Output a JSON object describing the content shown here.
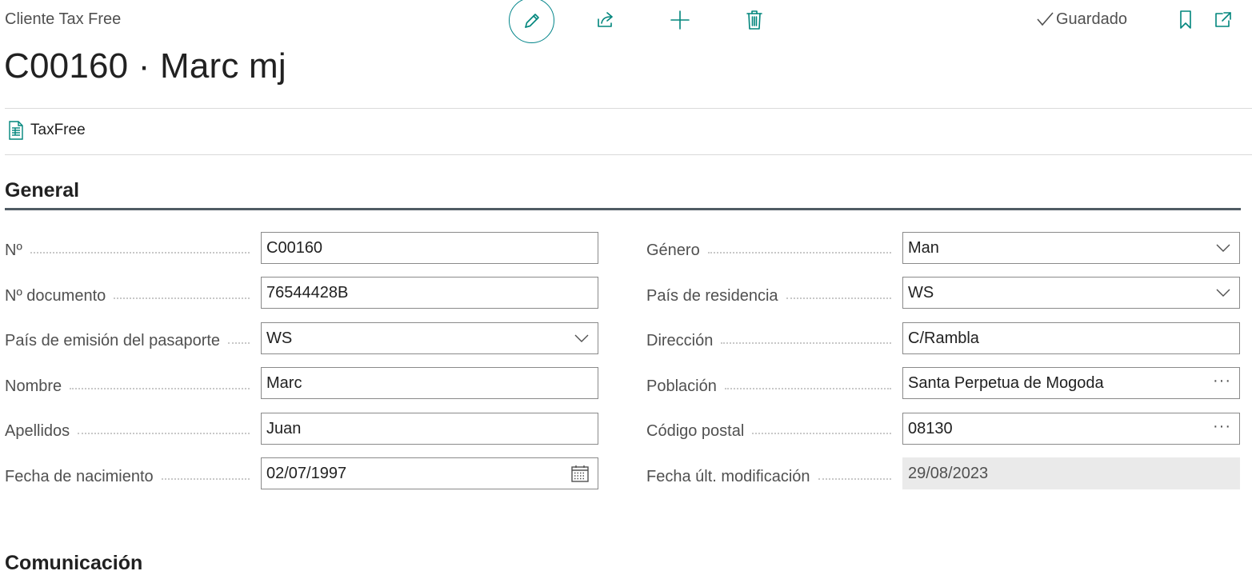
{
  "header": {
    "page_type": "Cliente Tax Free",
    "title": "C00160 · Marc mj",
    "saved_status": "Guardado",
    "actions": {
      "edit_icon": "pencil-icon",
      "share_icon": "share-icon",
      "new_icon": "plus-icon",
      "delete_icon": "trash-icon",
      "bookmark_icon": "bookmark-icon",
      "popout_icon": "open-in-new-window-icon"
    }
  },
  "promoted_actions": [
    {
      "label": "TaxFree",
      "icon": "document-report-icon"
    }
  ],
  "general": {
    "title": "General",
    "left_fields": [
      {
        "label": "Nº",
        "value": "C00160",
        "control": "text"
      },
      {
        "label": "Nº documento",
        "value": "76544428B",
        "control": "text"
      },
      {
        "label": "País de emisión del pasaporte",
        "value": "WS",
        "control": "dropdown"
      },
      {
        "label": "Nombre",
        "value": "Marc",
        "control": "text"
      },
      {
        "label": "Apellidos",
        "value": "Juan",
        "control": "text"
      },
      {
        "label": "Fecha de nacimiento",
        "value": "02/07/1997",
        "control": "date"
      }
    ],
    "right_fields": [
      {
        "label": "Género",
        "value": "Man",
        "control": "dropdown"
      },
      {
        "label": "País de residencia",
        "value": "WS",
        "control": "dropdown"
      },
      {
        "label": "Dirección",
        "value": "C/Rambla",
        "control": "text"
      },
      {
        "label": "Población",
        "value": "Santa Perpetua de Mogoda",
        "control": "lookup"
      },
      {
        "label": "Código postal",
        "value": "08130",
        "control": "lookup"
      },
      {
        "label": "Fecha últ. modificación",
        "value": "29/08/2023",
        "control": "readonly"
      }
    ]
  },
  "next_section": {
    "title": "Comunicación"
  },
  "colors": {
    "accent": "#00857c",
    "section_rule": "#505c64",
    "readonly_bg": "#eaeaea"
  }
}
